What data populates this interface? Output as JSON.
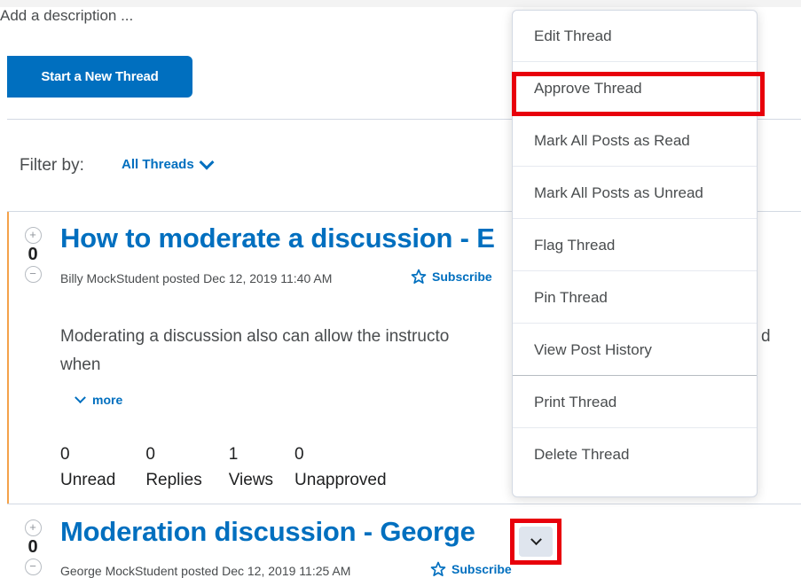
{
  "page": {
    "description_placeholder": "Add a description ...",
    "start_thread_label": "Start a New Thread",
    "filter_label": "Filter by:",
    "filter_value": "All Threads"
  },
  "threads": [
    {
      "vote_count": "0",
      "title": "How to moderate a discussion - E",
      "meta": "Billy MockStudent posted Dec 12, 2019 11:40 AM",
      "subscribe_label": "Subscribe",
      "body": "Moderating a discussion also can allow the instructo",
      "body_line2": "when",
      "body_tail": "d",
      "more_label": "more",
      "stats": [
        {
          "value": "0",
          "label": "Unread"
        },
        {
          "value": "0",
          "label": "Replies"
        },
        {
          "value": "1",
          "label": "Views"
        },
        {
          "value": "0",
          "label": "Unapproved"
        }
      ]
    },
    {
      "vote_count": "0",
      "title": "Moderation discussion - George",
      "meta": "George MockStudent posted Dec 12, 2019 11:25 AM",
      "subscribe_label": "Subscribe"
    }
  ],
  "context_menu": {
    "items": [
      "Edit Thread",
      "Approve Thread",
      "Mark All Posts as Read",
      "Mark All Posts as Unread",
      "Flag Thread",
      "Pin Thread",
      "View Post History",
      "Print Thread",
      "Delete Thread"
    ],
    "highlighted_item": "Approve Thread"
  },
  "colors": {
    "accent": "#006fbf",
    "highlight": "#e8000b",
    "thread_accent": "#f4a24a"
  }
}
